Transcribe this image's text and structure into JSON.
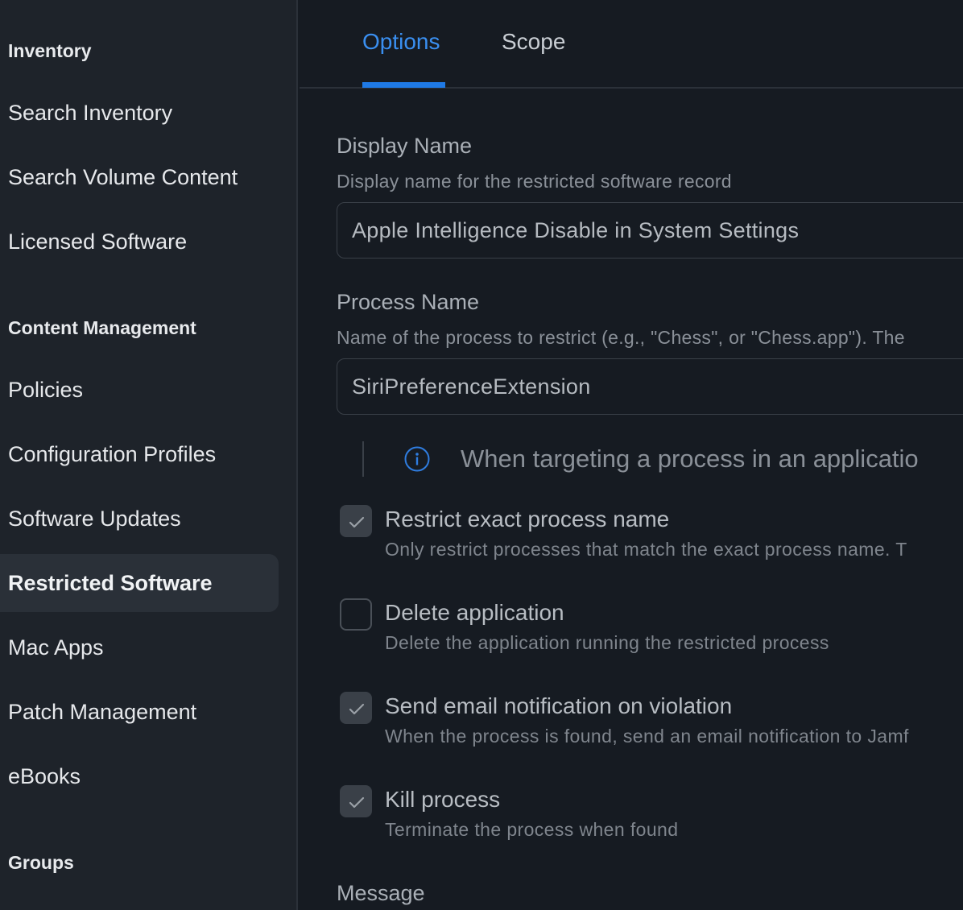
{
  "sidebar": {
    "sections": [
      {
        "heading": "Inventory",
        "items": [
          "Search Inventory",
          "Search Volume Content",
          "Licensed Software"
        ]
      },
      {
        "heading": "Content Management",
        "items": [
          "Policies",
          "Configuration Profiles",
          "Software Updates",
          "Restricted Software",
          "Mac Apps",
          "Patch Management",
          "eBooks"
        ]
      },
      {
        "heading": "Groups",
        "items": []
      }
    ],
    "active_item": "Restricted Software"
  },
  "tabs": [
    {
      "label": "Options",
      "active": true
    },
    {
      "label": "Scope",
      "active": false
    }
  ],
  "form": {
    "display_name": {
      "label": "Display Name",
      "help": "Display name for the restricted software record",
      "value": "Apple Intelligence Disable in System Settings"
    },
    "process_name": {
      "label": "Process Name",
      "help": "Name of the process to restrict (e.g., \"Chess\", or \"Chess.app\"). The",
      "value": "SiriPreferenceExtension"
    },
    "info_note": "When targeting a process in an applicatio",
    "options": [
      {
        "title": "Restrict exact process name",
        "desc": "Only restrict processes that match the exact process name. T",
        "checked": true
      },
      {
        "title": "Delete application",
        "desc": "Delete the application running the restricted process",
        "checked": false
      },
      {
        "title": "Send email notification on violation",
        "desc": "When the process is found, send an email notification to Jamf",
        "checked": true
      },
      {
        "title": "Kill process",
        "desc": "Terminate the process when found",
        "checked": true
      }
    ],
    "message": {
      "label": "Message"
    }
  },
  "colors": {
    "accent": "#1f7ae6",
    "sidebar_bg": "#1e232a",
    "main_bg": "#161b22",
    "info_icon": "#2f7de0"
  }
}
